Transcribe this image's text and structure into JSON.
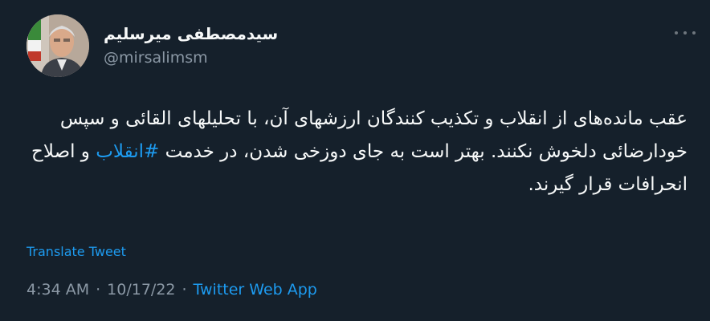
{
  "author": {
    "display_name": "سیدمصطفی میرسلیم",
    "handle": "@mirsalimsm"
  },
  "tweet": {
    "text_before_hashtag": "عقب مانده‌های از انقلاب و تکذیب کنندگان ارزشهای آن، با تحلیلهای القائی و سپس خودارضائی دلخوش نکنند. بهتر است به جای دوزخی شدن، در خدمت ",
    "hashtag": "#انقلاب",
    "text_after_hashtag": " و اصلاح انحرافات قرار گیرند."
  },
  "translate_label": "Translate Tweet",
  "meta": {
    "time": "4:34 AM",
    "separator": "·",
    "date": "10/17/22",
    "source": "Twitter Web App"
  },
  "colors": {
    "background": "#15202b",
    "text": "#f7f9f9",
    "secondary": "#8b98a5",
    "accent": "#1d9bf0"
  },
  "icons": {
    "more": "more-horizontal-icon"
  }
}
